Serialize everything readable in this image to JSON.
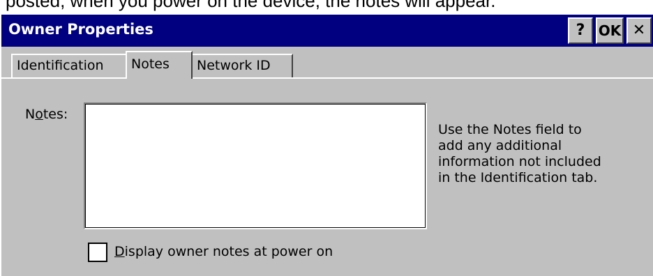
{
  "document": {
    "caption_text": "posted, when you power on the device, the notes will appear."
  },
  "window": {
    "title": "Owner Properties",
    "help_label": "?",
    "ok_label": "OK",
    "close_label": "✕",
    "help_icon": "question-mark-icon",
    "close_icon": "close-icon"
  },
  "tabs": [
    {
      "label": "Identification",
      "selected": false
    },
    {
      "label": "Notes",
      "selected": true
    },
    {
      "label": "Network ID",
      "selected": false
    }
  ],
  "notes_panel": {
    "notes_label_pre": "N",
    "notes_label_mnemonic": "o",
    "notes_label_post": "tes:",
    "notes_value": "",
    "help_lines": [
      "Use the Notes field to",
      "add any additional",
      "information not included",
      "in the Identification tab."
    ],
    "checkbox_checked": false,
    "checkbox_label_mnemonic": "D",
    "checkbox_label_rest": "isplay owner notes at power on"
  },
  "colors": {
    "titlebar": "#000080",
    "dialog_bg": "#c0c0c0",
    "title_text": "#ffffff"
  }
}
